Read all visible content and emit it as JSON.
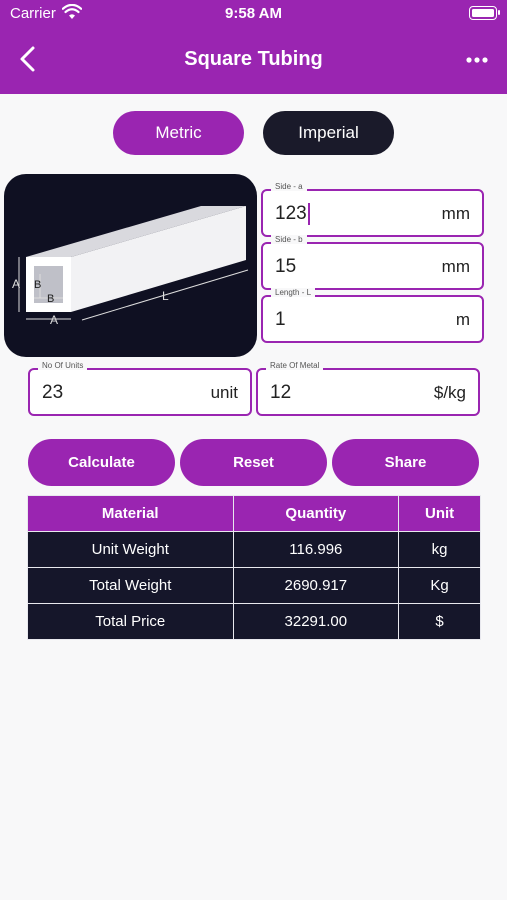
{
  "status": {
    "carrier": "Carrier",
    "time": "9:58 AM"
  },
  "header": {
    "title": "Square Tubing"
  },
  "units_toggle": {
    "metric": "Metric",
    "imperial": "Imperial"
  },
  "diagram": {
    "label_a1": "A",
    "label_b1": "B",
    "label_b2": "B",
    "label_a2": "A",
    "label_l": "L"
  },
  "fields": {
    "side_a": {
      "label": "Side - a",
      "value": "123",
      "unit": "mm"
    },
    "side_b": {
      "label": "Side - b",
      "value": "15",
      "unit": "mm"
    },
    "length": {
      "label": "Length - L",
      "value": "1",
      "unit": "m"
    },
    "units": {
      "label": "No Of Units",
      "value": "23",
      "unit": "unit"
    },
    "rate": {
      "label": "Rate Of Metal",
      "value": "12",
      "unit": "$/kg"
    }
  },
  "buttons": {
    "calculate": "Calculate",
    "reset": "Reset",
    "share": "Share"
  },
  "table": {
    "headers": [
      "Material",
      "Quantity",
      "Unit"
    ],
    "rows": [
      [
        "Unit Weight",
        "116.996",
        "kg"
      ],
      [
        "Total Weight",
        "2690.917",
        "Kg"
      ],
      [
        "Total Price",
        "32291.00",
        "$"
      ]
    ]
  },
  "colors": {
    "accent": "#9a25b1",
    "dark": "#15162a",
    "background": "#f8f8f9"
  }
}
